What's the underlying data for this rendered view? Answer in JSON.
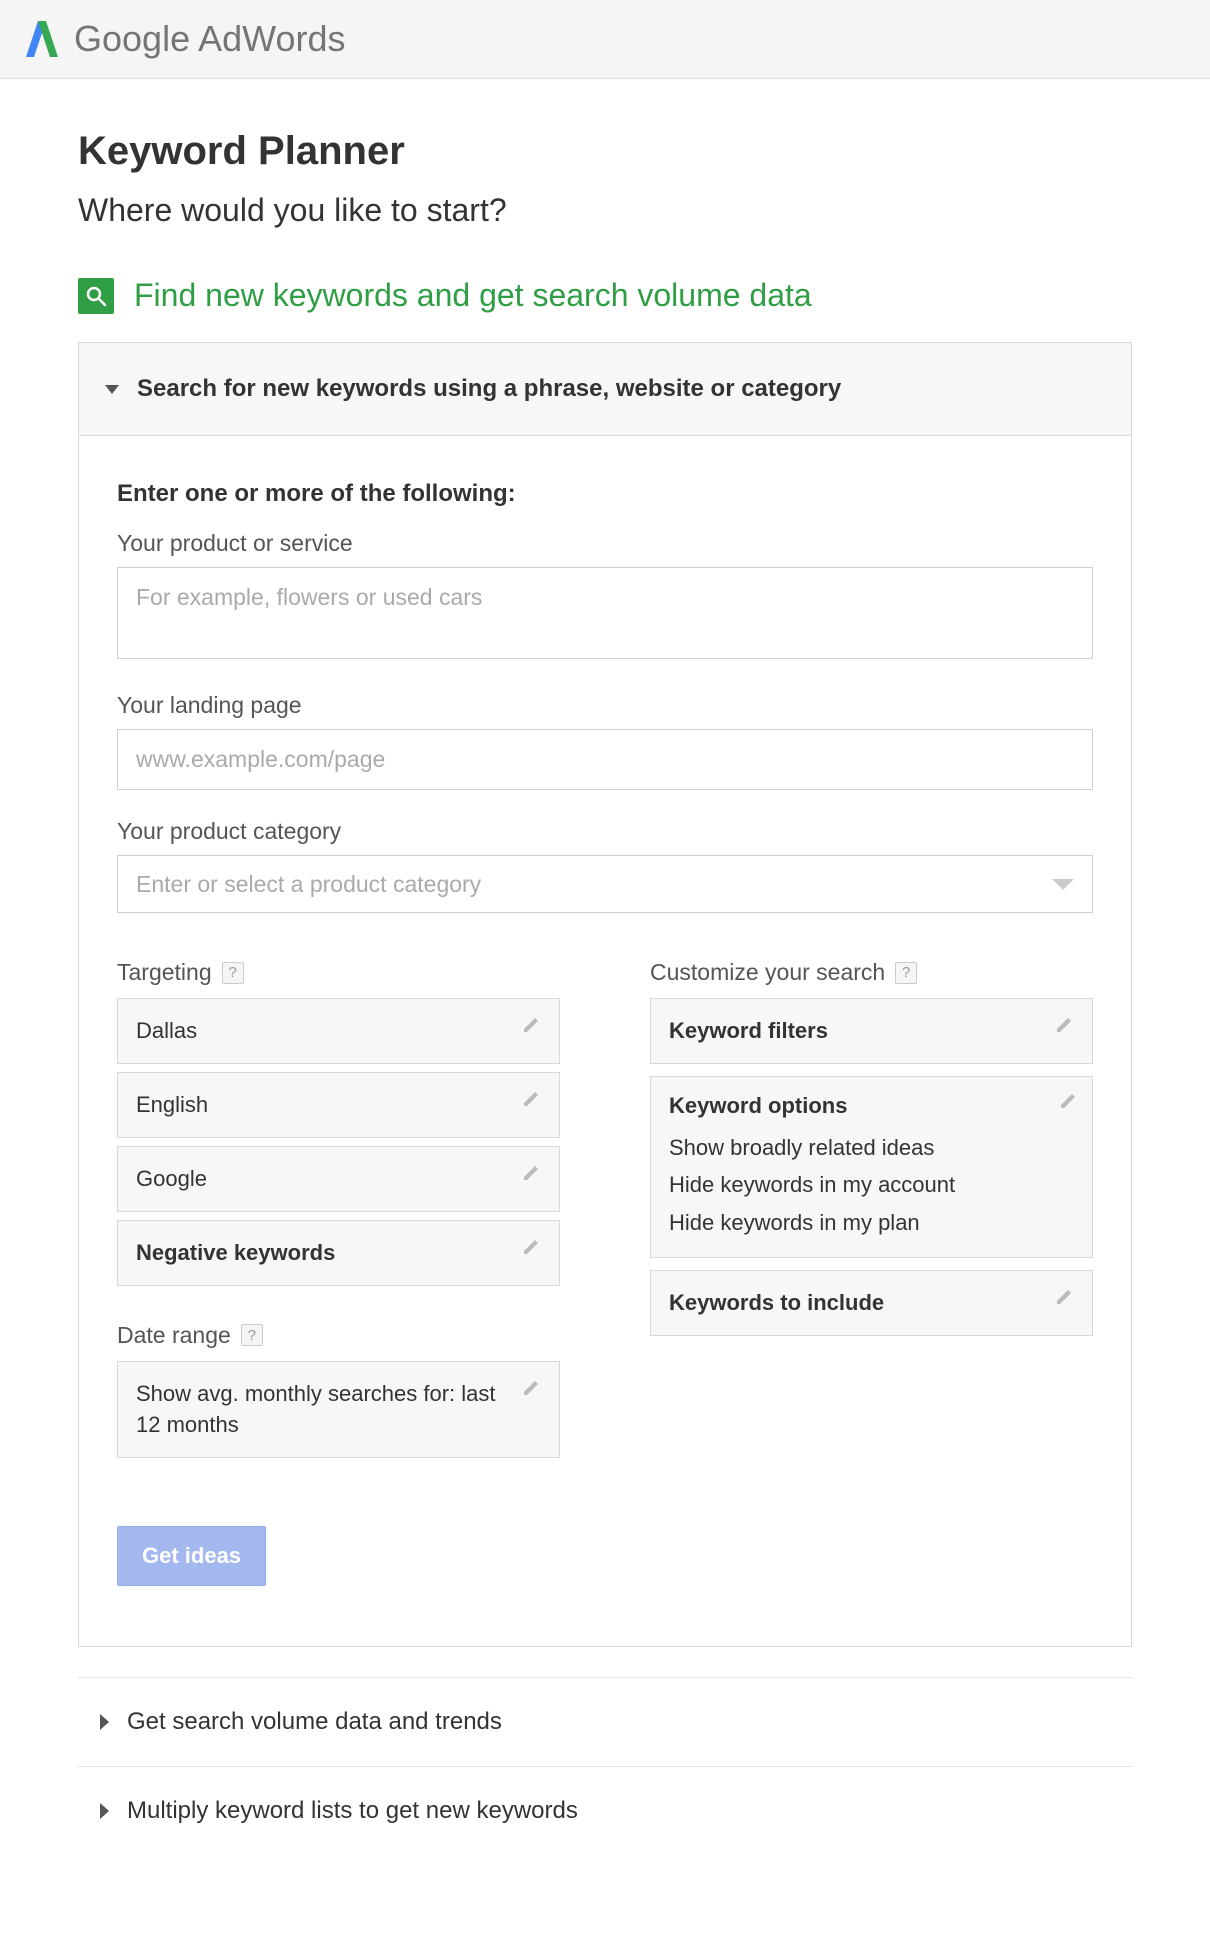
{
  "brand": {
    "google": "Google",
    "adwords": " AdWords"
  },
  "page": {
    "title": "Keyword Planner",
    "subtitle": "Where would you like to start?"
  },
  "section": {
    "title": "Find new keywords and get search volume data"
  },
  "panel": {
    "header": "Search for new keywords using a phrase, website or category"
  },
  "form": {
    "intro": "Enter one or more of the following:",
    "product_label": "Your product or service",
    "product_placeholder": "For example, flowers or used cars",
    "landing_label": "Your landing page",
    "landing_placeholder": "www.example.com/page",
    "category_label": "Your product category",
    "category_placeholder": "Enter or select a product category"
  },
  "targeting": {
    "heading": "Targeting",
    "location": "Dallas",
    "language": "English",
    "network": "Google",
    "negative": "Negative keywords"
  },
  "daterange": {
    "heading": "Date range",
    "value": "Show avg. monthly searches for: last 12 months"
  },
  "customize": {
    "heading": "Customize your search",
    "filters": "Keyword filters",
    "options_title": "Keyword options",
    "options_line1": "Show broadly related ideas",
    "options_line2": "Hide keywords in my account",
    "options_line3": "Hide keywords in my plan",
    "include": "Keywords to include"
  },
  "button": {
    "get_ideas": "Get ideas"
  },
  "collapsed": {
    "row1": "Get search volume data and trends",
    "row2": "Multiply keyword lists to get new keywords"
  },
  "help": "?"
}
